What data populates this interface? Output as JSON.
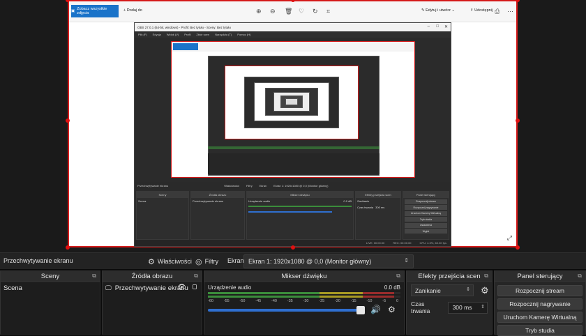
{
  "photo_viewer": {
    "see_all_label": "Zobacz wszystkie zdjęcia",
    "add_label": "Dodaj do",
    "edit_label": "Edytuj i utwórz",
    "share_label": "Udostępnij",
    "icons": [
      "zoom-in-icon",
      "zoom-out-icon",
      "delete-icon",
      "favorite-icon",
      "rotate-icon",
      "crop-icon",
      "print-icon",
      "more-icon",
      "expand-icon"
    ]
  },
  "inner_obs": {
    "title": "OBS 27.0.1 (64-bit, windows) - Profil: Bez tytułu - Sceny: Bez tytułu",
    "menu": [
      "Plik (F)",
      "Edycja",
      "Widok (V)",
      "Profil",
      "Zbiór scen",
      "Narzędzia (T)",
      "Pomoc (H)"
    ],
    "source_bar": {
      "name": "Przechwytywanie ekranu",
      "props": "Właściwości",
      "filters": "Filtry",
      "screen": "Ekran",
      "display": "Ekran 1: 1920x1080 @ 0,0 (Monitor główny)"
    },
    "panels": {
      "scenes": "Sceny",
      "sources": "Źródła obrazu",
      "mixer": "Mikser dźwięku",
      "transitions": "Efekty przejścia scen",
      "controls": "Panel sterujący"
    },
    "scene_item": "Scena",
    "source_item": "Przechwytywanie ekranu",
    "mixer_device": "Urządzenie audio",
    "mixer_db": "0.0 dB",
    "transition": "Zanikanie",
    "duration_label": "Czas trwania",
    "duration": "300 ms",
    "control_buttons": [
      "Rozpocznij stream",
      "Rozpocznij nagrywanie",
      "Uruchom Kamerę Wirtualną",
      "Tryb studia",
      "Ustawienia",
      "Wyjdź"
    ],
    "status": {
      "live": "LIVE: 00:00:00",
      "rec": "REC: 00:00:00",
      "cpu": "CPU: 4.3%, 60.00 fps"
    }
  },
  "source_bar": {
    "name": "Przechwytywanie ekranu",
    "properties_label": "Właściwości",
    "filters_label": "Filtry",
    "screen_label": "Ekran",
    "display_value": "Ekran 1: 1920x1080 @ 0,0 (Monitor główny)"
  },
  "scenes": {
    "title": "Sceny",
    "items": [
      "Scena"
    ]
  },
  "sources": {
    "title": "Źródła obrazu",
    "items": [
      "Przechwytywanie ekranu"
    ]
  },
  "mixer": {
    "title": "Mikser dźwięku",
    "device": "Urządzenie audio",
    "db": "0.0 dB",
    "ticks": [
      "-60",
      "-55",
      "-50",
      "-45",
      "-40",
      "-35",
      "-30",
      "-25",
      "-20",
      "-15",
      "-10",
      "-5",
      "0"
    ],
    "volume_level": 1.0
  },
  "transitions": {
    "title": "Efekty przejścia scen",
    "selected": "Zanikanie",
    "duration_label": "Czas trwania",
    "duration_value": "300 ms"
  },
  "controls": {
    "title": "Panel sterujący",
    "buttons": [
      "Rozpocznij stream",
      "Rozpocznij nagrywanie",
      "Uruchom Kamerę Wirtualną",
      "Tryb studia"
    ]
  },
  "colors": {
    "selection_red": "#d51a1a",
    "accent_blue": "#1a73c9",
    "fader_blue": "#2f6fd0",
    "meter_green": "#3b8d3b",
    "meter_yellow": "#a79a24",
    "meter_red": "#9b2c2c"
  }
}
